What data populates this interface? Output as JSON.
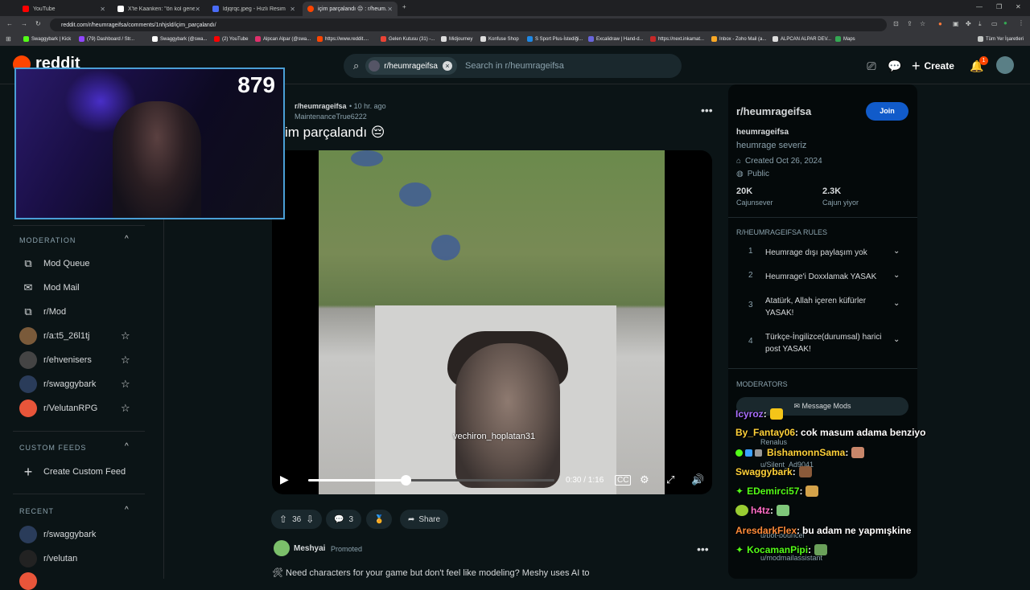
{
  "browser": {
    "tabs": [
      {
        "label": "YouTube",
        "color": "#ff0000"
      },
      {
        "label": "X'te Kaanken: \"ön kol genetiği...",
        "color": "#ffffff"
      },
      {
        "label": "ldjqrqc.jpeg - Hızlı Resim",
        "color": "#4a6cf7"
      },
      {
        "label": "içim parçalandı 😔 : r/heum...",
        "color": "#ff4500"
      }
    ],
    "url": "reddit.com/r/heumrageifsa/comments/1nhjsld/içim_parçalandı/",
    "bookmarks": [
      {
        "label": "Swaggybark | Kick",
        "color": "#53fc18"
      },
      {
        "label": "(79) Dashboard / Str...",
        "color": "#9146ff"
      },
      {
        "label": "Swaggybark (@swa...",
        "color": "#ffffff"
      },
      {
        "label": "(2) YouTube",
        "color": "#ff0000"
      },
      {
        "label": "Alpcan Alpar (@swa...",
        "color": "#e1306c"
      },
      {
        "label": "https://www.reddit....",
        "color": "#ff4500"
      },
      {
        "label": "Gelen Kutusu (31) -...",
        "color": "#ea4335"
      },
      {
        "label": "Midjourney",
        "color": "#ffffff"
      },
      {
        "label": "Konfuse Shop",
        "color": "#ffffff"
      },
      {
        "label": "S Sport Plus-İstediği...",
        "color": "#1e88e5"
      },
      {
        "label": "Excalidraw | Hand-d...",
        "color": "#6965db"
      },
      {
        "label": "https://next.inkamat...",
        "color": "#c62828"
      },
      {
        "label": "Inbox - Zoho Mail (a...",
        "color": "#f9a825"
      },
      {
        "label": "ALPCAN ALPAR DEV...",
        "color": "#ffffff"
      },
      {
        "label": "Maps",
        "color": "#34a853"
      }
    ],
    "all_bookmarks_label": "Tüm Yer İşaretleri"
  },
  "reddit": {
    "logo_text": "reddit",
    "search": {
      "chip_label": "r/heumrageifsa",
      "placeholder": "Search in r/heumrageifsa"
    },
    "create_label": "Create",
    "notification_count": "1"
  },
  "webcam": {
    "counter": "879"
  },
  "left_nav": {
    "moderation_head": "MODERATION",
    "moderation_items": [
      {
        "label": "Mod Queue",
        "icon": "mod-queue-icon"
      },
      {
        "label": "Mod Mail",
        "icon": "mail-icon"
      },
      {
        "label": "r/Mod",
        "icon": "mod-icon"
      },
      {
        "label": "r/a:t5_26l1tj",
        "icon": "community-avatar"
      },
      {
        "label": "r/ehvenisers",
        "icon": "community-avatar"
      },
      {
        "label": "r/swaggybark",
        "icon": "community-avatar"
      },
      {
        "label": "r/VelutanRPG",
        "icon": "community-avatar"
      }
    ],
    "custom_feeds_head": "CUSTOM FEEDS",
    "create_custom_feed": "Create Custom Feed",
    "recent_head": "RECENT",
    "recent_items": [
      "r/swaggybark",
      "r/velutan"
    ]
  },
  "post": {
    "subreddit": "r/heumrageifsa",
    "time": "• 10 hr. ago",
    "author": "MaintenanceTrue6222",
    "title": "İçim parçalandı 😔",
    "title_visible": "im parçalandı 😔",
    "video": {
      "watermark": "vechiron_hoplatan31",
      "time": "0:30 / 1:16",
      "progress": 0.395
    },
    "votes": "36",
    "comments": "3",
    "share_label": "Share"
  },
  "promoted": {
    "user": "Meshyai",
    "tag": "Promoted",
    "text": "🛠 Need characters for your game but don't feel like modeling? Meshy uses AI to"
  },
  "sidebar": {
    "title": "r/heumrageifsa",
    "join_label": "Join",
    "name": "heumrageifsa",
    "description": "heumrage severiz",
    "created": "Created Oct 26, 2024",
    "visibility": "Public",
    "members_value": "20K",
    "members_label": "Cajunsever",
    "online_value": "2.3K",
    "online_label": "Cajun yiyor",
    "rules_head": "R/HEUMRAGEIFSA RULES",
    "rules": [
      {
        "num": "1",
        "text": "Heumrage dışı paylaşım yok"
      },
      {
        "num": "2",
        "text": "Heumrage'i Doxxlamak YASAK"
      },
      {
        "num": "3",
        "text": "Atatürk, Allah içeren küfürler YASAK!"
      },
      {
        "num": "4",
        "text": "Türkçe-İngilizce(durumsal) harici post YASAK!"
      }
    ],
    "moderators_head": "MODERATORS",
    "message_mods_label": "Message Mods",
    "moderator_names": [
      "Renalus",
      "u/Silent_Ad9041",
      "u/bot-bouncer",
      "u/modmailassistant"
    ]
  },
  "chat": [
    {
      "user": "Icyroz",
      "color": "#a970ff",
      "sep": " :",
      "message": ""
    },
    {
      "user": "By_Fantay06",
      "color": "#ffd23a",
      "sep": " :",
      "message": "cok masum adama benziyo"
    },
    {
      "user": "BishamonnSama",
      "color": "#ffd23a",
      "sep": " :",
      "message": ""
    },
    {
      "user": "Swaggybark",
      "color": "#ffd23a",
      "sep": " :",
      "message": ""
    },
    {
      "user": "EDemirci57",
      "color": "#53fc18",
      "sep": " :",
      "message": ""
    },
    {
      "user": "h4tz",
      "color": "#ff6ec7",
      "sep": " :",
      "message": ""
    },
    {
      "user": "AresdarkFlex",
      "color": "#ff8c3a",
      "sep": " :",
      "message": "bu adam ne yapmışkine"
    },
    {
      "user": "KocamanPipi",
      "color": "#53fc18",
      "sep": " :",
      "message": ""
    }
  ]
}
